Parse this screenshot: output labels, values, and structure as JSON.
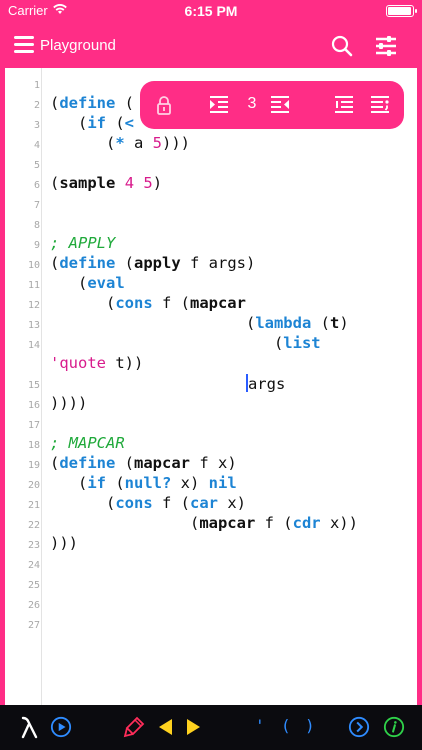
{
  "status_bar": {
    "carrier": "Carrier",
    "time": "6:15 PM",
    "battery_level": 1.0
  },
  "nav": {
    "title": "Playground",
    "menu_icon": "hamburger-icon",
    "search_icon": "search-icon",
    "settings_icon": "sliders-icon"
  },
  "floating_toolbar": {
    "indent_count": "3",
    "icons": [
      "lock-icon",
      "indent-icon",
      "outdent-icon",
      "align-right-icon",
      "comment-lines-icon"
    ]
  },
  "editor": {
    "line_numbers": [
      "1",
      "2",
      "3",
      "4",
      "5",
      "6",
      "7",
      "8",
      "9",
      "10",
      "11",
      "12",
      "13",
      "14",
      "",
      "15",
      "16",
      "17",
      "18",
      "19",
      "20",
      "21",
      "22",
      "23",
      "24",
      "25",
      "26",
      "27"
    ],
    "lines": {
      "l2_a": "(",
      "l2_kw": "define",
      "l2_b": " (",
      "l3_a": "   (",
      "l3_kw": "if",
      "l3_b": " (",
      "l3_kw2": "<",
      "l4_a": "      (",
      "l4_kw": "*",
      "l4_b": " a ",
      "l4_num": "5",
      "l4_c": ")))",
      "l6_a": "(",
      "l6_fn": "sample",
      "l6_b": " ",
      "l6_num1": "4",
      "l6_c": " ",
      "l6_num2": "5",
      "l6_d": ")",
      "l9_cm": "; APPLY",
      "l10_a": "(",
      "l10_kw": "define",
      "l10_b": " (",
      "l10_fn": "apply",
      "l10_c": " f args)",
      "l11_a": "   (",
      "l11_kw": "eval",
      "l12_a": "      (",
      "l12_kw": "cons",
      "l12_b": " f (",
      "l12_fn": "mapcar",
      "l13_a": "                     (",
      "l13_kw": "lambda",
      "l13_b": " (",
      "l13_fn": "t",
      "l13_c": ")",
      "l14_a": "                        (",
      "l14_kw": "list",
      "l14b_q": "'quote",
      "l14b_b": " t))",
      "l15_a": "                     ",
      "l15_b": "args",
      "l16_a": "))))",
      "l18_cm": "; MAPCAR",
      "l19_a": "(",
      "l19_kw": "define",
      "l19_b": " (",
      "l19_fn": "mapcar",
      "l19_c": " f x)",
      "l20_a": "   (",
      "l20_kw": "if",
      "l20_b": " (",
      "l20_kw2": "null?",
      "l20_c": " x) ",
      "l20_kw3": "nil",
      "l21_a": "      (",
      "l21_kw": "cons",
      "l21_b": " f (",
      "l21_kw2": "car",
      "l21_c": " x)",
      "l22_a": "               (",
      "l22_fn": "mapcar",
      "l22_b": " f (",
      "l22_kw": "cdr",
      "l22_c": " x))",
      "l23_a": ")))"
    }
  },
  "bottom_bar": {
    "quote_key": "'",
    "open_paren_key": "(",
    "close_paren_key": ")",
    "icons": [
      "lambda-icon",
      "play-icon",
      "marker-icon",
      "arrow-left-icon",
      "arrow-right-icon",
      "chevron-right-circle-icon",
      "info-circle-icon"
    ]
  },
  "colors": {
    "accent": "#ff2d86",
    "keyword": "#1d84d4",
    "number": "#d81b8c",
    "comment": "#1fa93a",
    "bottom_bar": "#0b0b0f"
  }
}
